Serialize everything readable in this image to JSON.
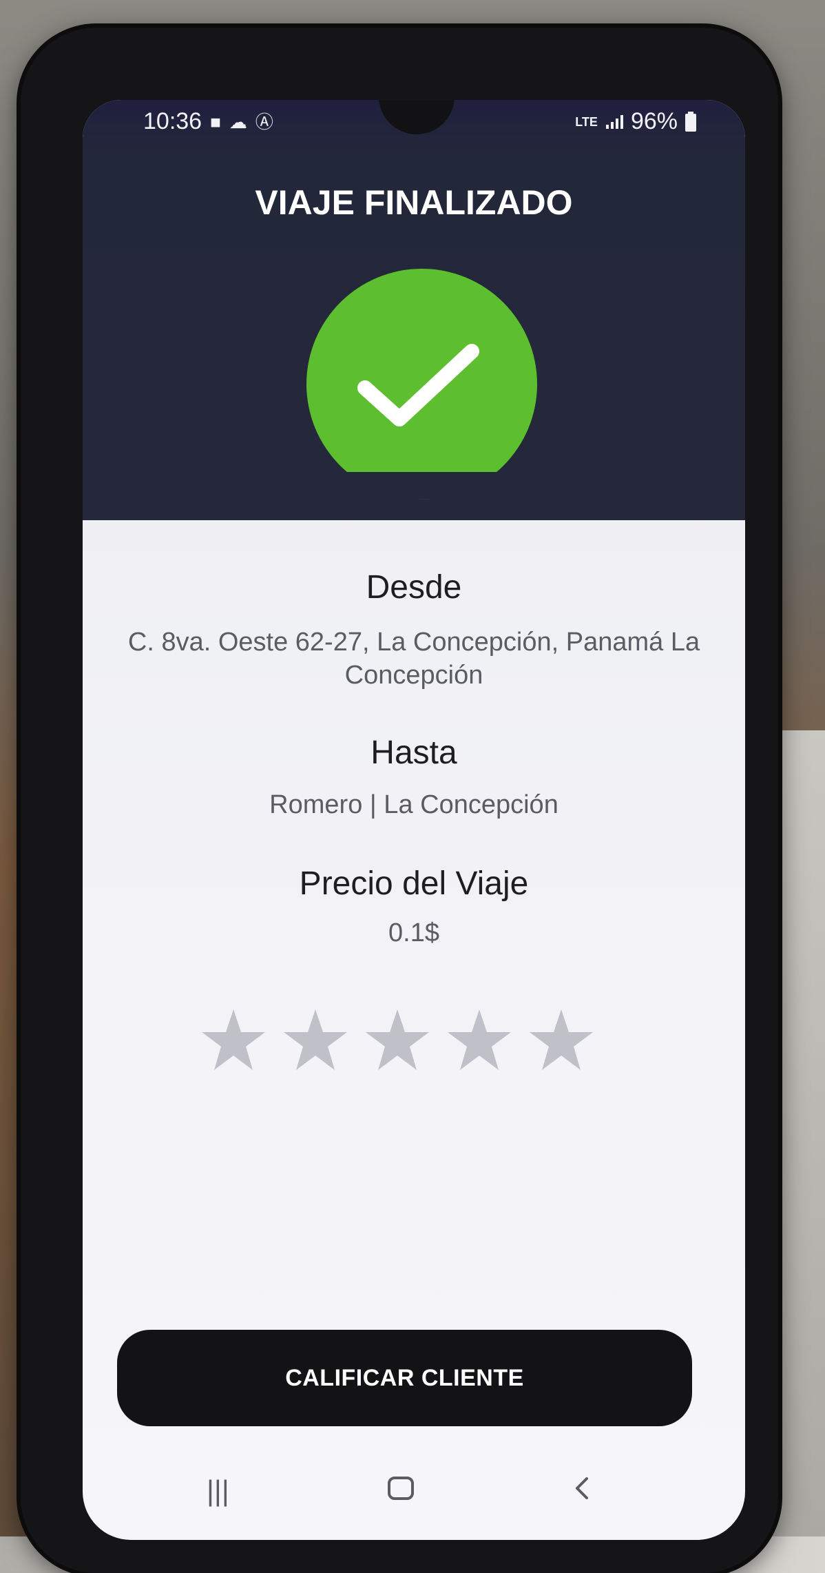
{
  "status_bar": {
    "time": "10:36",
    "network": "LTE",
    "battery": "96%"
  },
  "header": {
    "title": "VIAJE FINALIZADO",
    "accent_color": "#5dbf2f"
  },
  "trip": {
    "from_label": "Desde",
    "from_value_line1": "C. 8va. Oeste 62-27, La Concepción, Panamá La",
    "from_value_line2": "Concepción",
    "to_label": "Hasta",
    "to_value": "Romero | La Concepción",
    "price_label": "Precio del Viaje",
    "price_value": "0.1$"
  },
  "rating": {
    "stars_total": 5,
    "stars_selected": 0
  },
  "actions": {
    "rate_client_label": "CALIFICAR CLIENTE"
  },
  "navigation": {
    "items": [
      "recents-icon",
      "home-icon",
      "back-icon"
    ]
  }
}
